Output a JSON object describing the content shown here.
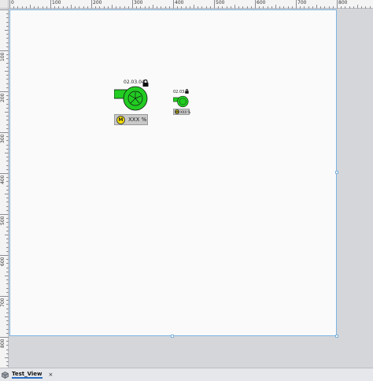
{
  "ruler": {
    "h_labels": [
      "0",
      "100",
      "200",
      "300",
      "400",
      "500",
      "600",
      "700",
      "800"
    ],
    "v_labels": [
      "100",
      "200",
      "300",
      "400",
      "500",
      "600",
      "700",
      "800"
    ]
  },
  "canvas": {
    "pumps": [
      {
        "id": "02.03.04",
        "mode_badge": "M",
        "value": "XXX %",
        "color": "#22cc22"
      },
      {
        "id": "02.03.0",
        "mode_badge": "M",
        "value": "XXX %",
        "color": "#22cc22"
      }
    ]
  },
  "tabs": [
    {
      "label": "Test_View",
      "close": "×",
      "icon": "view-icon"
    }
  ],
  "colors": {
    "pump": "#22cc22",
    "badge": "#ffe500",
    "selection": "#7fb4e0",
    "tab_underline": "#2d6fc4"
  }
}
